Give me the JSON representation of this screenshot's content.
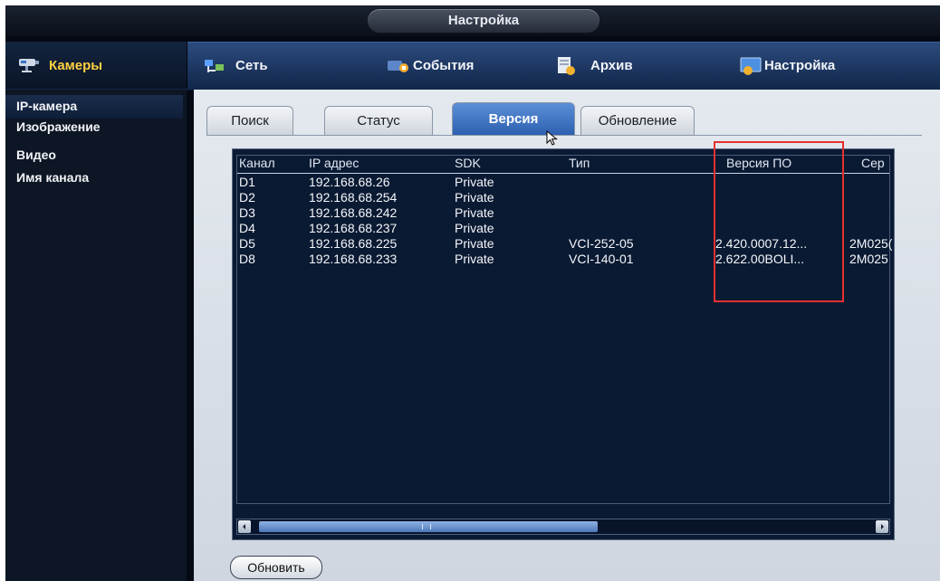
{
  "window": {
    "title": "Настройка"
  },
  "menu": {
    "cameras": "Камеры",
    "network": "Сеть",
    "events": "События",
    "archive": "Архив",
    "settings": "Настройка"
  },
  "sidebar": {
    "items": [
      "IP-камера",
      "Изображение",
      "Видео",
      "Имя канала"
    ],
    "active_index": 0
  },
  "tabs": {
    "items": [
      "Поиск",
      "Статус",
      "Версия",
      "Обновление"
    ],
    "active": "Версия"
  },
  "table": {
    "columns": [
      "Канал",
      "IP адрес",
      "SDK",
      "Тип",
      "Версия ПО",
      "Сер"
    ],
    "rows": [
      [
        "D1",
        "192.168.68.26",
        "Private",
        "",
        "",
        ""
      ],
      [
        "D2",
        "192.168.68.254",
        "Private",
        "",
        "",
        ""
      ],
      [
        "D3",
        "192.168.68.242",
        "Private",
        "",
        "",
        ""
      ],
      [
        "D4",
        "192.168.68.237",
        "Private",
        "",
        "",
        ""
      ],
      [
        "D5",
        "192.168.68.225",
        "Private",
        "VCI-252-05",
        "2.420.0007.12...",
        "2M025("
      ],
      [
        "D8",
        "192.168.68.233",
        "Private",
        "VCI-140-01",
        "2.622.00BOLI...",
        "2M025"
      ]
    ]
  },
  "actions": {
    "refresh": "Обновить"
  },
  "colors": {
    "accent": "#2c5fae",
    "highlight": "#e53030",
    "menu_yellow": "#ffd040"
  },
  "icons": {
    "cameras": "cctv-camera-icon",
    "network": "network-icon",
    "events": "events-icon",
    "archive": "archive-icon",
    "settings": "settings-monitor-icon",
    "cursor": "mouse-cursor-icon"
  }
}
